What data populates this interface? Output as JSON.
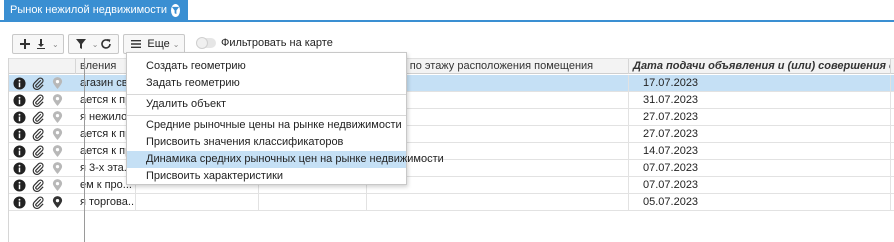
{
  "tab": {
    "title": "Рынок нежилой недвижимости",
    "close": "×"
  },
  "toolbar": {
    "add_icon": "plus-icon",
    "download_icon": "download-icon",
    "filter_icon": "filter-icon",
    "refresh_icon": "refresh-icon",
    "menu_icon": "hamburger-icon",
    "more_label": "Еще",
    "toggle_label": "Фильтровать на карте"
  },
  "grid": {
    "columns": [
      "вления",
      "",
      "",
      "икация по этажу расположения помещения",
      "Дата подачи объявления и (или) совершения сде..."
    ],
    "rows": [
      {
        "name": "агазин сво...",
        "date": "17.07.2023",
        "selected": true
      },
      {
        "name": "ается к пр...",
        "date": "31.07.2023"
      },
      {
        "name": "я нежило...",
        "date": "27.07.2023"
      },
      {
        "name": "ается к пр...",
        "date": "27.07.2023"
      },
      {
        "name": "ается к пр...",
        "date": "14.07.2023"
      },
      {
        "name": "я 3-х эта...",
        "date": "07.07.2023"
      },
      {
        "name": "ем к про...",
        "date": "07.07.2023"
      },
      {
        "name": "я торгова...",
        "date": "05.07.2023"
      }
    ]
  },
  "menu": {
    "items": [
      "Создать геометрию",
      "Задать геометрию",
      "Удалить объект",
      "Средние рыночные цены на рынке недвижимости",
      "Присвоить значения классификаторов",
      "Динамика средних рыночных цен на рынке недвижимости",
      "Присвоить характеристики"
    ],
    "highlighted_index": 5
  },
  "colors": {
    "accent": "#3a8fd2",
    "selection": "#c5e0f5"
  }
}
